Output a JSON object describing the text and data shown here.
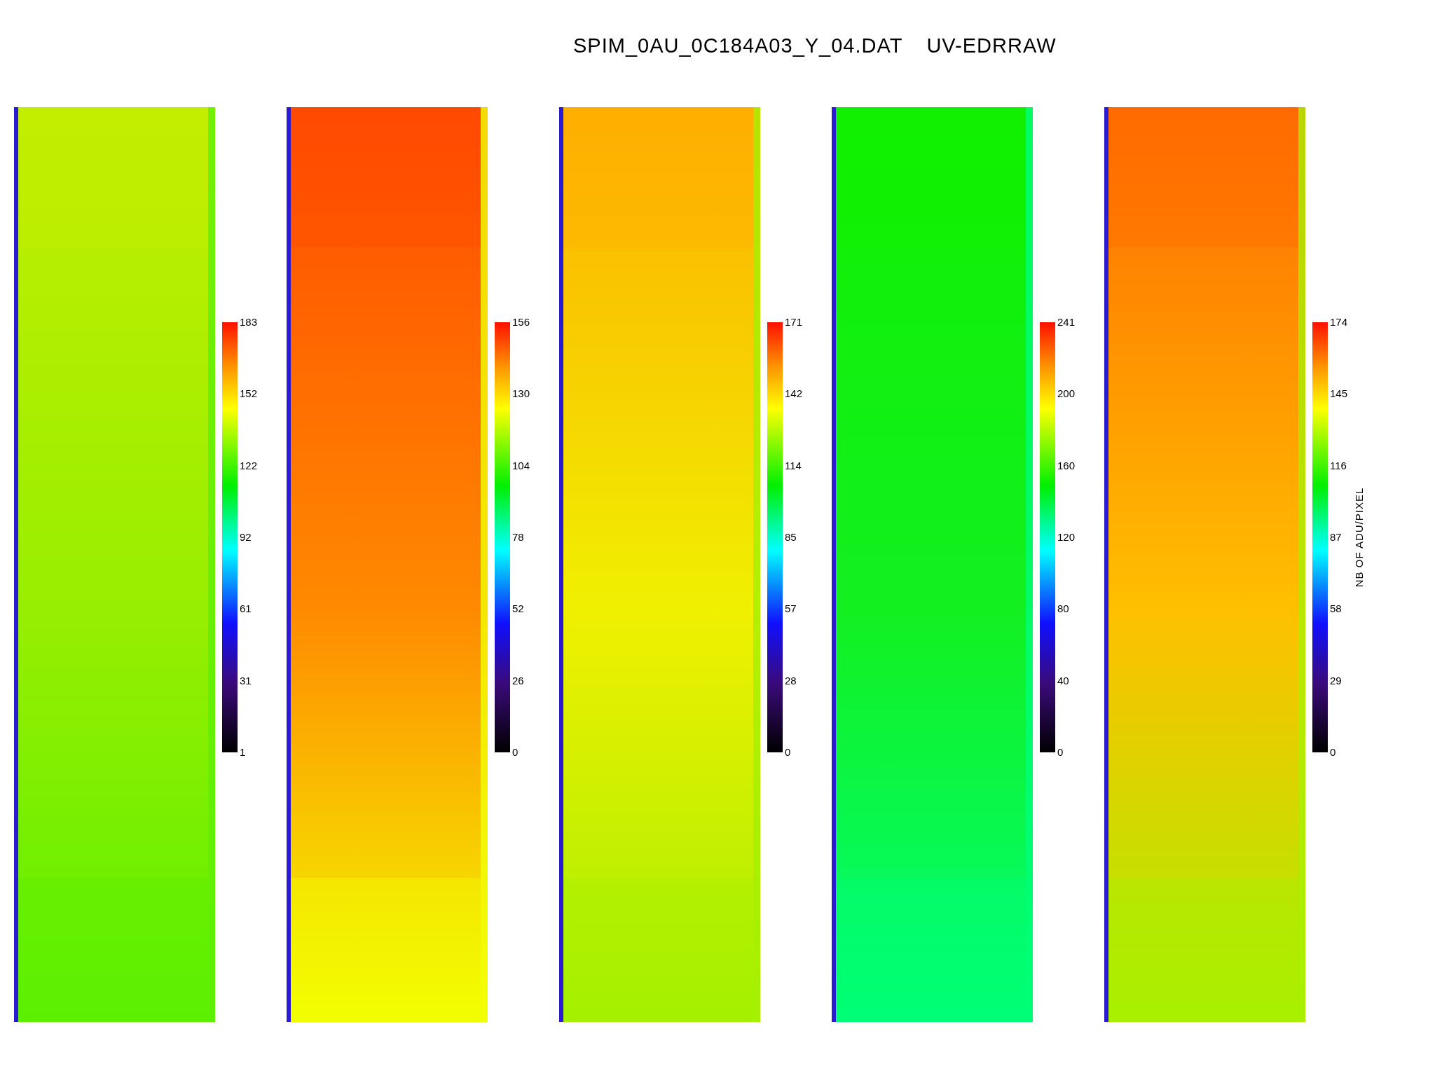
{
  "title": {
    "file": "SPIM_0AU_0C184A03_Y_04.DAT",
    "mode": "UV-EDRRAW"
  },
  "panels": [
    {
      "colorbar": {
        "ticks": [
          "183",
          "152",
          "122",
          "92",
          "61",
          "31",
          "1"
        ]
      }
    },
    {
      "colorbar": {
        "ticks": [
          "156",
          "130",
          "104",
          "78",
          "52",
          "26",
          "0"
        ]
      }
    },
    {
      "colorbar": {
        "ticks": [
          "171",
          "142",
          "114",
          "85",
          "57",
          "28",
          "0"
        ]
      }
    },
    {
      "colorbar": {
        "ticks": [
          "241",
          "200",
          "160",
          "120",
          "80",
          "40",
          "0"
        ]
      }
    },
    {
      "colorbar": {
        "ticks": [
          "174",
          "145",
          "116",
          "87",
          "58",
          "29",
          "0"
        ],
        "axis_label": "NB OF ADU/PIXEL"
      }
    }
  ]
}
